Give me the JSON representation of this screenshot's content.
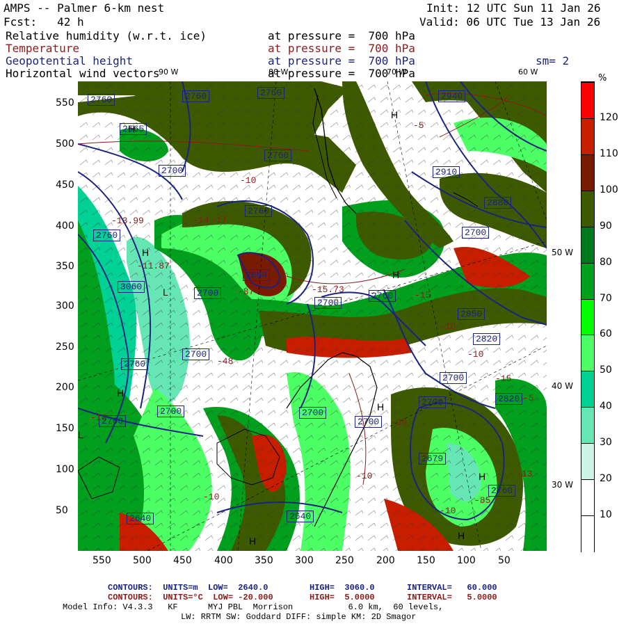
{
  "header": {
    "title": "AMPS -- Palmer 6-km nest",
    "fcst": "Fcst:   42 h",
    "init": "Init: 12 UTC Sun 11 Jan 26",
    "valid": "Valid: 06 UTC Tue 13 Jan 26"
  },
  "fields": [
    {
      "name": "Relative humidity (w.r.t. ice)",
      "level": "at pressure =  700 hPa",
      "color": "#000000"
    },
    {
      "name": "Temperature",
      "level": "at pressure =  700 hPa",
      "color": "#8b1a1a"
    },
    {
      "name": "Geopotential height",
      "level": "at pressure =  700 hPa",
      "color": "#1a237e",
      "extra": "sm= 2"
    },
    {
      "name": "Horizontal wind vectors",
      "level": "at pressure =  700 hPa",
      "color": "#000000"
    }
  ],
  "map": {
    "x_ticks": [
      "550",
      "500",
      "450",
      "400",
      "350",
      "300",
      "250",
      "200",
      "150",
      "100",
      "50"
    ],
    "y_ticks": [
      "550",
      "500",
      "450",
      "400",
      "350",
      "300",
      "250",
      "200",
      "150",
      "100",
      "50"
    ],
    "lon_labels_top": [
      "90 W",
      "80 W",
      "70 W",
      "60 W"
    ],
    "lon_labels_right": [
      "50 W",
      "40 W",
      "30 W"
    ],
    "height_contour_labels": [
      "2760",
      "2665",
      "2700",
      "2760",
      "3060",
      "2940",
      "2910",
      "2880",
      "2700",
      "2760",
      "2654",
      "2700",
      "2700",
      "2760",
      "2850",
      "2820",
      "2700",
      "2760",
      "2700",
      "2760",
      "2700",
      "2700",
      "2700",
      "2700",
      "2820",
      "2760",
      "2760",
      "2760",
      "2679",
      "2640",
      "2640",
      "2760"
    ],
    "temp_contour_labels": [
      "-10",
      "-13.99",
      "-11.87",
      "-14",
      "-17",
      "-15.73",
      "-10",
      "-18",
      "-10",
      "-5",
      "-5",
      "-15",
      "-26",
      "-13",
      "-10",
      "-10",
      "-15",
      "-10",
      "-87",
      "-48",
      "-85"
    ],
    "pressure_markers": [
      "H",
      "H",
      "H",
      "L",
      "H",
      "H",
      "H",
      "H",
      "H",
      "H",
      "L"
    ]
  },
  "legend": {
    "unit": "%",
    "ticks": [
      "120",
      "110",
      "100",
      "90",
      "80",
      "70",
      "60",
      "50",
      "40",
      "30",
      "20",
      "10"
    ],
    "colors": [
      "#ff0000",
      "#c81e00",
      "#7a1a00",
      "#3e5a00",
      "#00781e",
      "#00a01e",
      "#00ff00",
      "#4cff64",
      "#00d296",
      "#66e6b4",
      "#ccf5e6",
      "#ffffff",
      "#ffffff"
    ]
  },
  "footer": {
    "line1_a": "CONTOURS:  UNITS=m  LOW=  2640.0",
    "line1_b": "HIGH=  3060.0",
    "line1_c": "INTERVAL=   60.000",
    "line2_a": "CONTOURS:  UNITS=°C  LOW= -20.000",
    "line2_b": "HIGH=  5.0000",
    "line2_c": "INTERVAL=   5.0000",
    "line3": "Model Info: V4.3.3   KF      MYJ PBL  Morrison           6.0 km,  60 levels,",
    "line4": "LW: RRTM SW: Goddard DIFF: simple KM: 2D Smagor"
  }
}
